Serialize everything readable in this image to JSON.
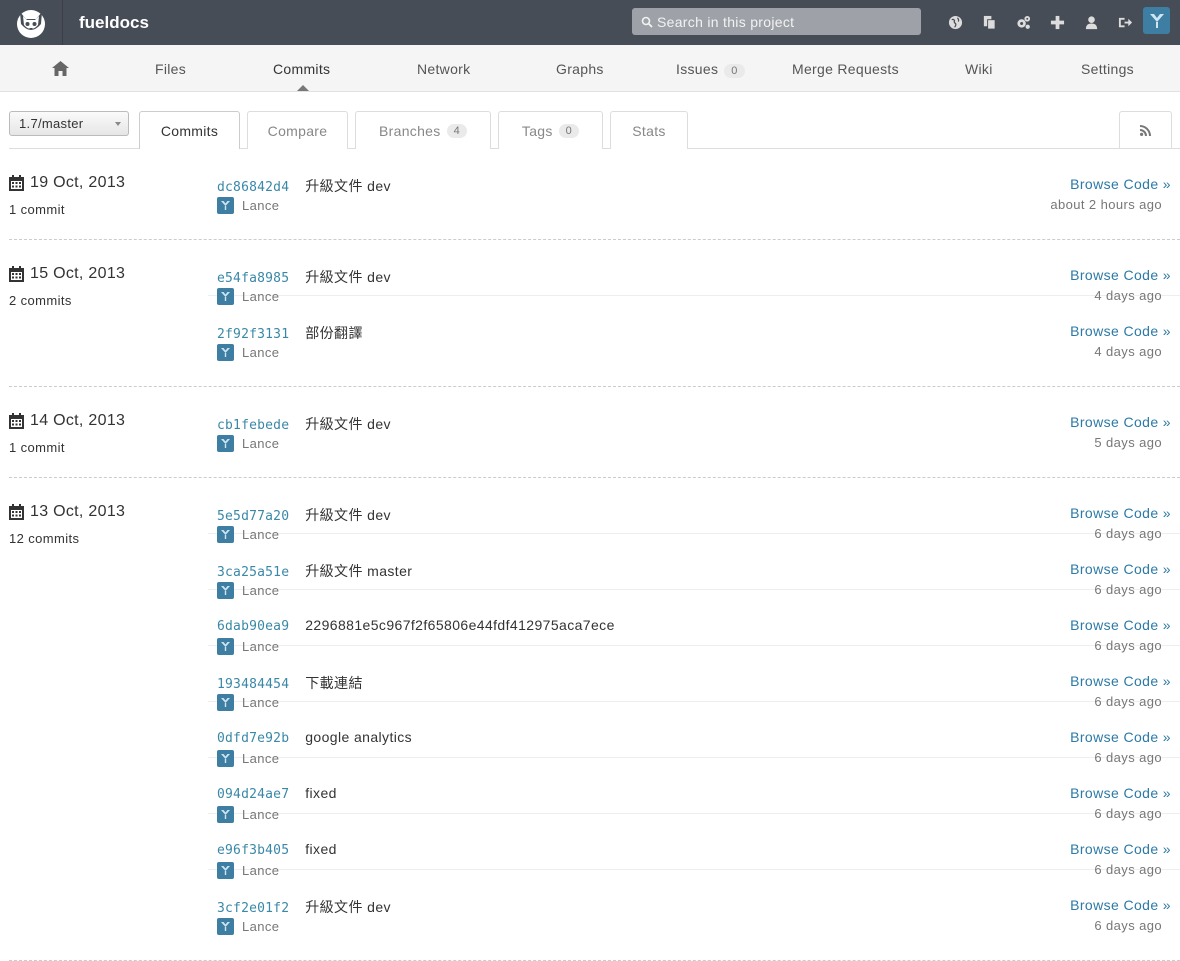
{
  "header": {
    "project": "fueldocs",
    "search_placeholder": "Search in this project",
    "icons": [
      "globe-icon",
      "copy-icon",
      "cogs-icon",
      "plus-icon",
      "user-icon",
      "sign-out-icon"
    ]
  },
  "nav": {
    "items": [
      {
        "label": "Files"
      },
      {
        "label": "Commits"
      },
      {
        "label": "Network"
      },
      {
        "label": "Graphs"
      },
      {
        "label": "Issues",
        "badge": "0"
      },
      {
        "label": "Merge Requests"
      },
      {
        "label": "Wiki"
      },
      {
        "label": "Settings"
      }
    ]
  },
  "subnav": {
    "branch": "1.7/master",
    "tabs": [
      {
        "label": "Commits"
      },
      {
        "label": "Compare"
      },
      {
        "label": "Branches",
        "badge": "4"
      },
      {
        "label": "Tags",
        "badge": "0"
      },
      {
        "label": "Stats"
      }
    ]
  },
  "browse_label": "Browse Code »",
  "groups": [
    {
      "date": "19 Oct, 2013",
      "count": "1 commit",
      "commits": [
        {
          "sha": "dc86842d4",
          "message": "升級文件 dev",
          "author": "Lance",
          "time": "about 2 hours ago"
        }
      ]
    },
    {
      "date": "15 Oct, 2013",
      "count": "2 commits",
      "commits": [
        {
          "sha": "e54fa8985",
          "message": "升級文件 dev",
          "author": "Lance",
          "time": "4 days ago"
        },
        {
          "sha": "2f92f3131",
          "message": "部份翻譯",
          "author": "Lance",
          "time": "4 days ago"
        }
      ]
    },
    {
      "date": "14 Oct, 2013",
      "count": "1 commit",
      "commits": [
        {
          "sha": "cb1febede",
          "message": "升級文件 dev",
          "author": "Lance",
          "time": "5 days ago"
        }
      ]
    },
    {
      "date": "13 Oct, 2013",
      "count": "12 commits",
      "commits": [
        {
          "sha": "5e5d77a20",
          "message": "升級文件 dev",
          "author": "Lance",
          "time": "6 days ago"
        },
        {
          "sha": "3ca25a51e",
          "message": "升級文件 master",
          "author": "Lance",
          "time": "6 days ago"
        },
        {
          "sha": "6dab90ea9",
          "message": "2296881e5c967f2f65806e44fdf412975aca7ece",
          "author": "Lance",
          "time": "6 days ago"
        },
        {
          "sha": "193484454",
          "message": "下載連結",
          "author": "Lance",
          "time": "6 days ago"
        },
        {
          "sha": "0dfd7e92b",
          "message": "google analytics",
          "author": "Lance",
          "time": "6 days ago"
        },
        {
          "sha": "094d24ae7",
          "message": "fixed",
          "author": "Lance",
          "time": "6 days ago"
        },
        {
          "sha": "e96f3b405",
          "message": "fixed",
          "author": "Lance",
          "time": "6 days ago"
        },
        {
          "sha": "3cf2e01f2",
          "message": "升級文件 dev",
          "author": "Lance",
          "time": "6 days ago"
        }
      ]
    }
  ]
}
